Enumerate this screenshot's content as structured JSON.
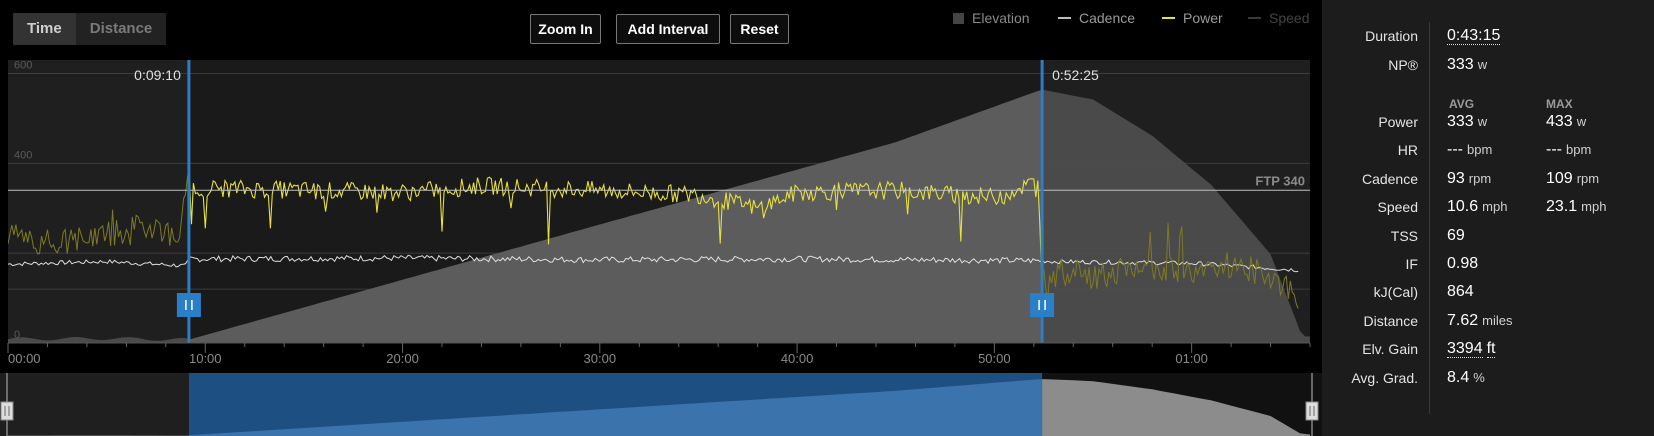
{
  "toggle": {
    "time": "Time",
    "distance": "Distance"
  },
  "toolbar": {
    "zoom_in": "Zoom In",
    "add_interval": "Add Interval",
    "reset": "Reset"
  },
  "legend": [
    {
      "label": "Elevation",
      "color": "#444444"
    },
    {
      "label": "Cadence",
      "color": "#bdbdbd"
    },
    {
      "label": "Power",
      "color": "#e6e03c"
    },
    {
      "label": "Speed",
      "color": "#3a3a3a"
    }
  ],
  "interval": {
    "start_label": "0:09:10",
    "end_label": "0:52:25"
  },
  "ftp_label": "FTP 340",
  "chart_data": {
    "type": "line",
    "x_unit": "time (h:mm)",
    "xlim": [
      "00:00",
      "01:06:00"
    ],
    "ylim": [
      0,
      630
    ],
    "y_ticks": [
      {
        "value": 0,
        "label": "0"
      },
      {
        "value": 400,
        "label": "400"
      },
      {
        "value": 600,
        "label": "600"
      }
    ],
    "y_gridlines": [
      120,
      200,
      400,
      600
    ],
    "x_ticks": [
      {
        "minute": 0,
        "label": "00:00"
      },
      {
        "minute": 10,
        "label": "10:00"
      },
      {
        "minute": 20,
        "label": "20:00"
      },
      {
        "minute": 30,
        "label": "30:00"
      },
      {
        "minute": 40,
        "label": "40:00"
      },
      {
        "minute": 50,
        "label": "50:00"
      },
      {
        "minute": 60,
        "label": "01:00"
      }
    ],
    "ftp_watts": 340,
    "selection_minutes": [
      9.17,
      52.42
    ],
    "series": [
      {
        "name": "Power",
        "color": "#e6e03c",
        "minutes": [
          0,
          2,
          4,
          6,
          7.5,
          8.5,
          9.2,
          10,
          15,
          20,
          24,
          30,
          35,
          38,
          40,
          45,
          48,
          50,
          51,
          52.2,
          52.4,
          53,
          55,
          58,
          60,
          62,
          64,
          65.5
        ],
        "watts": [
          245,
          215,
          235,
          250,
          265,
          230,
          345,
          345,
          340,
          335,
          350,
          340,
          330,
          300,
          335,
          340,
          330,
          325,
          340,
          360,
          150,
          160,
          150,
          170,
          160,
          175,
          150,
          100
        ]
      },
      {
        "name": "Cadence",
        "color": "#dcdcdc",
        "minutes": [
          0,
          5,
          9,
          9.2,
          20,
          30,
          40,
          52.4,
          53,
          60,
          65.5
        ],
        "values": [
          92,
          95,
          90,
          98,
          99,
          97,
          98,
          96,
          95,
          93,
          85
        ]
      },
      {
        "name": "Elevation",
        "color": "#4f4f4f",
        "minutes": [
          0,
          5,
          9.17,
          30,
          45,
          52.4,
          55,
          58,
          61,
          64,
          65.6
        ],
        "feet": [
          60,
          70,
          50,
          1800,
          3050,
          3850,
          3700,
          3150,
          2400,
          1350,
          100
        ]
      }
    ]
  },
  "stats": {
    "duration": {
      "label": "Duration",
      "value": "0:43:15"
    },
    "np": {
      "label": "NP®",
      "value": "333",
      "unit": "w"
    },
    "columns": {
      "avg": "AVG",
      "max": "MAX"
    },
    "rows": [
      {
        "label": "Power",
        "avg": "333",
        "avg_unit": "w",
        "max": "433",
        "max_unit": "w"
      },
      {
        "label": "HR",
        "avg": "---",
        "avg_unit": "bpm",
        "max": "---",
        "max_unit": "bpm"
      },
      {
        "label": "Cadence",
        "avg": "93",
        "avg_unit": "rpm",
        "max": "109",
        "max_unit": "rpm"
      },
      {
        "label": "Speed",
        "avg": "10.6",
        "avg_unit": "mph",
        "max": "23.1",
        "max_unit": "mph"
      },
      {
        "label": "TSS",
        "avg": "69",
        "avg_unit": ""
      },
      {
        "label": "IF",
        "avg": "0.98",
        "avg_unit": ""
      },
      {
        "label": "kJ(Cal)",
        "avg": "864",
        "avg_unit": ""
      },
      {
        "label": "Distance",
        "avg": "7.62",
        "avg_unit": "miles"
      },
      {
        "label": "Elv. Gain",
        "avg": "3394",
        "avg_unit": "ft"
      },
      {
        "label": "Avg. Grad.",
        "avg": "8.4",
        "avg_unit": "%"
      }
    ]
  }
}
